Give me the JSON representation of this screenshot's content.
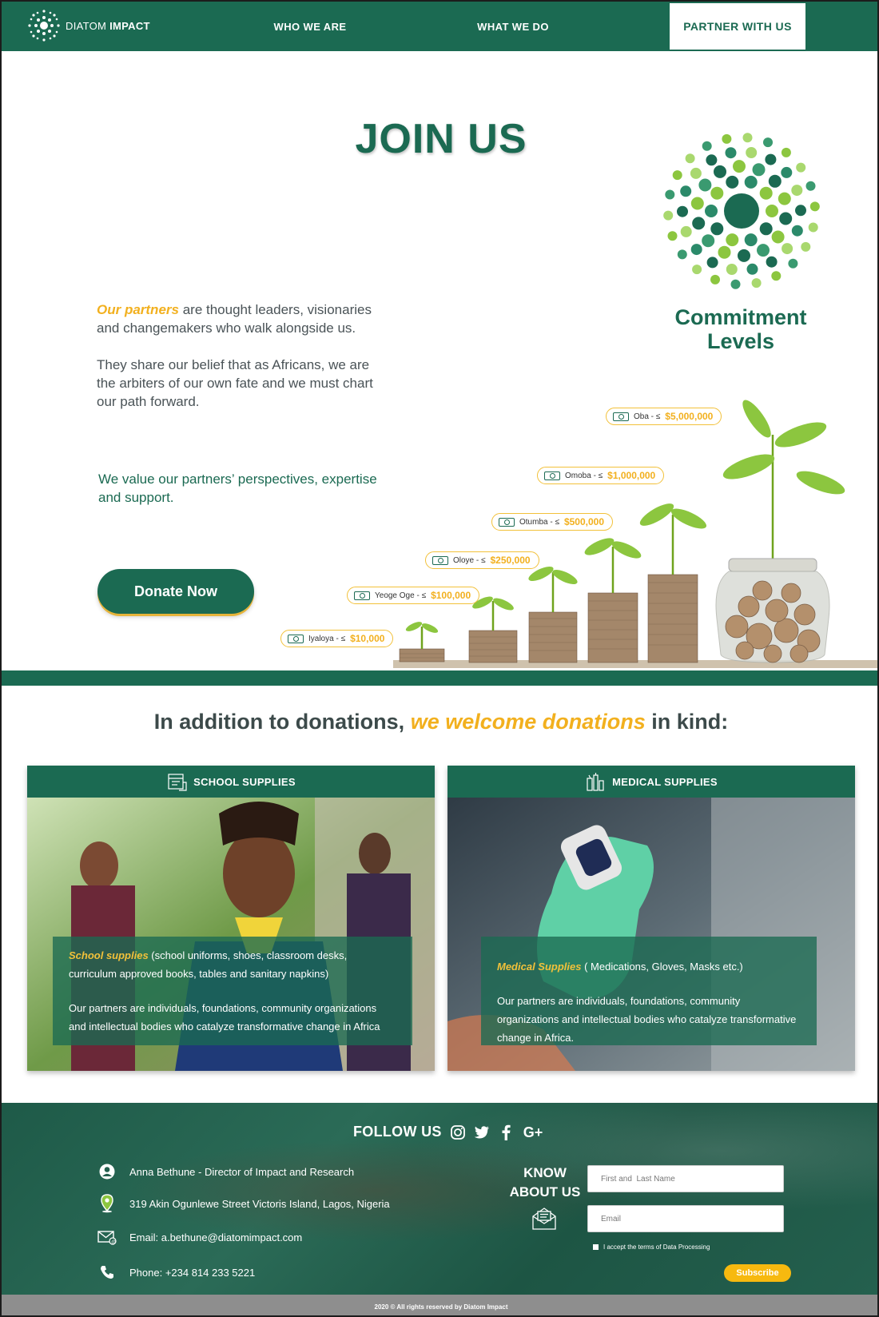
{
  "brand": {
    "logo_light": "DIATOM",
    "logo_bold": "IMPACT",
    "primary_color": "#1b6a52",
    "accent_color": "#f2b01e"
  },
  "nav": {
    "items": [
      {
        "label": "WHO WE ARE"
      },
      {
        "label": "WHAT WE DO"
      },
      {
        "label": "PARTNER WITH US",
        "active": true
      }
    ]
  },
  "hero": {
    "title": "JOIN US",
    "p1_accent": "Our partners",
    "p1_rest": " are thought leaders, visionaries and changemakers who walk alongside us.",
    "p2": "They share our belief that as Africans, we are the arbiters of our own fate and we must chart our path forward.",
    "value_text": "We value our partners’ perspectives, expertise and support.",
    "donate_label": "Donate Now",
    "commitment_line1": "Commitment",
    "commitment_line2": "Levels"
  },
  "tiers": [
    {
      "name": "Oba - ≤ ",
      "amount": "$5,000,000"
    },
    {
      "name": "Omoba - ≤ ",
      "amount": "$1,000,000"
    },
    {
      "name": "Otumba - ≤ ",
      "amount": "$500,000"
    },
    {
      "name": "Oloye - ≤ ",
      "amount": "$250,000"
    },
    {
      "name": "Yeoge Oge - ≤ ",
      "amount": "$100,000"
    },
    {
      "name": "Iyaloya - ≤ ",
      "amount": "$10,000"
    }
  ],
  "inkind": {
    "title_start": "In addition to donations, ",
    "title_highlight": "we welcome donations",
    "title_end": " in kind:",
    "school": {
      "header": "SCHOOL SUPPLIES",
      "accent": "School supplies",
      "rest": " (school uniforms, shoes, classroom desks, curriculum approved books, tables and sanitary napkins)",
      "para": "Our partners are individuals, foundations, community organizations and intellectual bodies who catalyze transformative change in Africa"
    },
    "medical": {
      "header": "MEDICAL SUPPLIES",
      "accent": "Medical Supplies",
      "rest": " ( Medications, Gloves, Masks etc.)",
      "para": "Our partners are individuals, foundations, community organizations and intellectual bodies who catalyze transformative change in Africa."
    }
  },
  "footer": {
    "follow_label": "FOLLOW US",
    "socials": [
      "instagram-icon",
      "twitter-icon",
      "facebook-icon",
      "google-plus-icon"
    ],
    "contact_name": "Anna Bethune - Director of Impact and Research",
    "address": "319 Akin Ogunlewe Street Victoris Island, Lagos, Nigeria",
    "email": "Email: a.bethune@diatomimpact.com",
    "phone": "Phone: +234 814 233 5221",
    "know_line1": "KNOW",
    "know_line2": "ABOUT US",
    "name_placeholder": "First and  Last Name",
    "email_placeholder": "Email",
    "terms_label": "I accept the terms of Data Processing",
    "subscribe_label": "Subscribe",
    "copyright": "2020 © All rights reserved by Diatom Impact"
  }
}
